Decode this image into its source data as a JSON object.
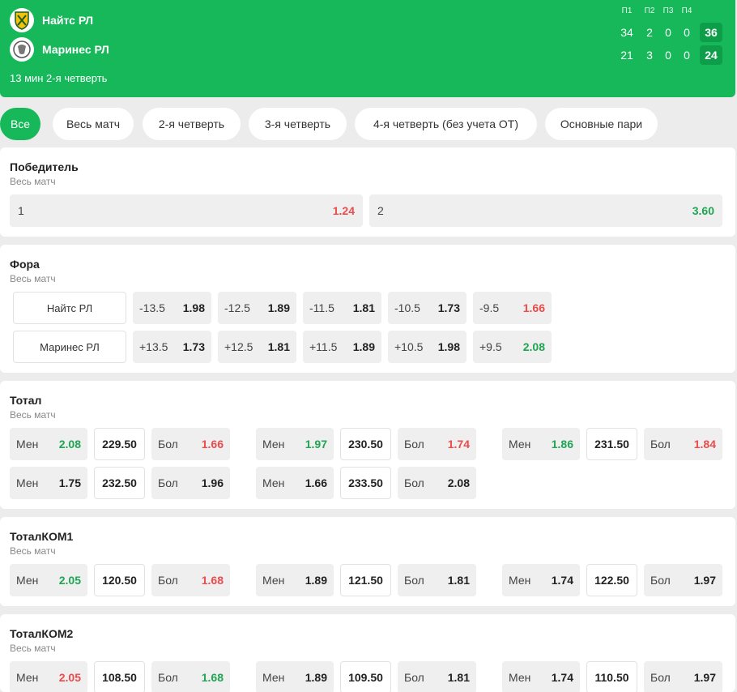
{
  "header": {
    "team1": "Найтс РЛ",
    "team2": "Маринес РЛ",
    "time": "13 мин 2-я четверть",
    "period_labels": [
      "П1",
      "П2",
      "П3",
      "П4"
    ],
    "team1_scores": [
      "34",
      "2",
      "0",
      "0"
    ],
    "team2_scores": [
      "21",
      "3",
      "0",
      "0"
    ],
    "team1_total": "36",
    "team2_total": "24"
  },
  "tabs": [
    "Все",
    "Весь матч",
    "2-я четверть",
    "3-я четверть",
    "4-я четверть (без учета ОТ)",
    "Основные пари"
  ],
  "winner": {
    "title": "Победитель",
    "sub": "Весь матч",
    "outcome1_label": "1",
    "outcome1_odd": "1.24",
    "outcome2_label": "2",
    "outcome2_odd": "3.60"
  },
  "handicap": {
    "title": "Фора",
    "sub": "Весь матч",
    "team1": "Найтс РЛ",
    "team2": "Маринес РЛ",
    "row1": [
      {
        "line": "-13.5",
        "odd": "1.98"
      },
      {
        "line": "-12.5",
        "odd": "1.89"
      },
      {
        "line": "-11.5",
        "odd": "1.81"
      },
      {
        "line": "-10.5",
        "odd": "1.73"
      },
      {
        "line": "-9.5",
        "odd": "1.66"
      }
    ],
    "row2": [
      {
        "line": "+13.5",
        "odd": "1.73"
      },
      {
        "line": "+12.5",
        "odd": "1.81"
      },
      {
        "line": "+11.5",
        "odd": "1.89"
      },
      {
        "line": "+10.5",
        "odd": "1.98"
      },
      {
        "line": "+9.5",
        "odd": "2.08"
      }
    ]
  },
  "labels": {
    "under": "Мен",
    "over": "Бол"
  },
  "total": {
    "title": "Тотал",
    "sub": "Весь матч",
    "groups": [
      {
        "under": "2.08",
        "line": "229.50",
        "over": "1.66"
      },
      {
        "under": "1.97",
        "line": "230.50",
        "over": "1.74"
      },
      {
        "under": "1.86",
        "line": "231.50",
        "over": "1.84"
      },
      {
        "under": "1.75",
        "line": "232.50",
        "over": "1.96"
      },
      {
        "under": "1.66",
        "line": "233.50",
        "over": "2.08"
      }
    ]
  },
  "total1": {
    "title": "ТоталКОМ1",
    "sub": "Весь матч",
    "groups": [
      {
        "under": "2.05",
        "line": "120.50",
        "over": "1.68"
      },
      {
        "under": "1.89",
        "line": "121.50",
        "over": "1.81"
      },
      {
        "under": "1.74",
        "line": "122.50",
        "over": "1.97"
      }
    ]
  },
  "total2": {
    "title": "ТоталКОМ2",
    "sub": "Весь матч",
    "groups": [
      {
        "under": "2.05",
        "line": "108.50",
        "over": "1.68"
      },
      {
        "under": "1.89",
        "line": "109.50",
        "over": "1.81"
      },
      {
        "under": "1.74",
        "line": "110.50",
        "over": "1.97"
      }
    ]
  },
  "colors": {
    "accent": "#16b85a",
    "odd_up": "#1ea652",
    "odd_down": "#ec4b4b"
  }
}
